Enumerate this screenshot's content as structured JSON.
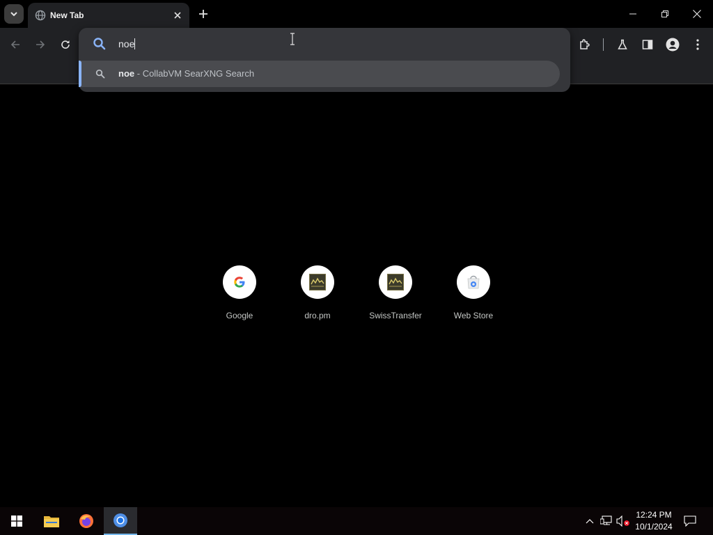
{
  "tab": {
    "title": "New Tab"
  },
  "omnibox": {
    "value": "noe"
  },
  "suggestion": {
    "query": "noe",
    "separator": " - ",
    "engine": "CollabVM SearXNG Search"
  },
  "shortcuts": [
    {
      "label": "Google",
      "icon": "google-g-icon"
    },
    {
      "label": "dro.pm",
      "icon": "dark-site-favicon"
    },
    {
      "label": "SwissTransfer",
      "icon": "dark-site-favicon"
    },
    {
      "label": "Web Store",
      "icon": "web-store-icon"
    }
  ],
  "taskbar": {
    "time": "12:24 PM",
    "date": "10/1/2024"
  },
  "colors": {
    "accent": "#8ab4f8",
    "toolbar": "#202124",
    "omnibox": "#35363a",
    "suggestion_highlight": "#4a4b4f"
  }
}
